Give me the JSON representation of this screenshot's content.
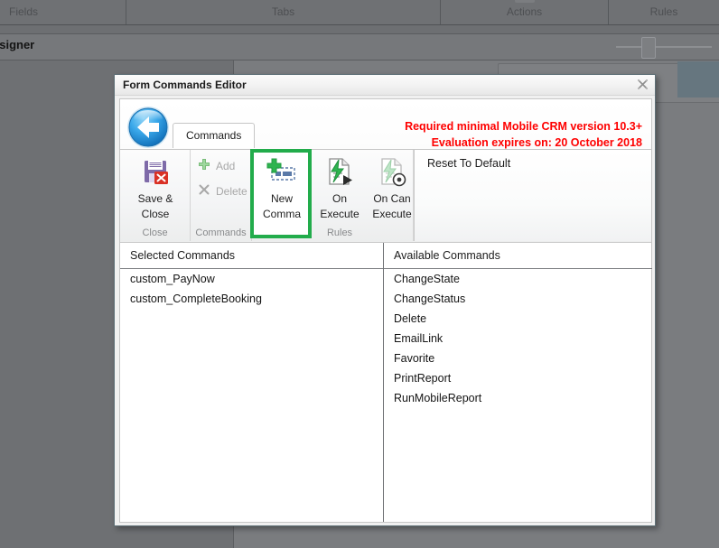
{
  "background": {
    "tabs": [
      {
        "label": "Fields"
      },
      {
        "label": "Tabs"
      },
      {
        "label": "Actions"
      },
      {
        "label": "Rules"
      }
    ],
    "designer_label": "esigner",
    "selected_panel_text": "...",
    "zoom_slider_name": "zoom-slider"
  },
  "dialog": {
    "title": "Form Commands Editor",
    "close_label": "Close",
    "back_button_label": "Back",
    "ribbon": {
      "tabs": [
        {
          "label": "Commands",
          "active": true
        }
      ],
      "warning_line1": "Required minimal Mobile CRM version 10.3+",
      "warning_line2": "Evaluation expires on: 20 October 2018",
      "warning_color": "#fe0000",
      "groups": [
        {
          "name": "Close",
          "label": "Close",
          "buttons": [
            {
              "label_line1": "Save &",
              "label_line2": "Close",
              "icon": "save-close-icon",
              "enabled": true
            }
          ]
        },
        {
          "name": "Commands",
          "label": "Commands",
          "buttons": [
            {
              "label": "Add",
              "icon": "plus-icon",
              "enabled": false
            },
            {
              "label": "Delete",
              "icon": "x-icon",
              "enabled": false
            }
          ]
        },
        {
          "name": "NewCommand",
          "label": "",
          "highlight_color": "#22ac4b",
          "buttons": [
            {
              "label_line1": "New",
              "label_line2": "Comma",
              "icon": "new-command-icon",
              "enabled": true,
              "highlighted": true
            }
          ]
        },
        {
          "name": "Rules",
          "label": "Rules",
          "buttons": [
            {
              "label_line1": "On",
              "label_line2": "Execute",
              "icon": "on-execute-icon",
              "enabled": true
            },
            {
              "label_line1": "On Can",
              "label_line2": "Execute",
              "icon": "on-can-execute-icon",
              "enabled": true
            }
          ]
        }
      ],
      "reset_to_default": "Reset To Default"
    },
    "lists": {
      "selected": {
        "header": "Selected Commands",
        "items": [
          "custom_PayNow",
          "custom_CompleteBooking"
        ]
      },
      "available": {
        "header": "Available Commands",
        "items": [
          "ChangeState",
          "ChangeStatus",
          "Delete",
          "EmailLink",
          "Favorite",
          "PrintReport",
          "RunMobileReport"
        ]
      }
    }
  }
}
